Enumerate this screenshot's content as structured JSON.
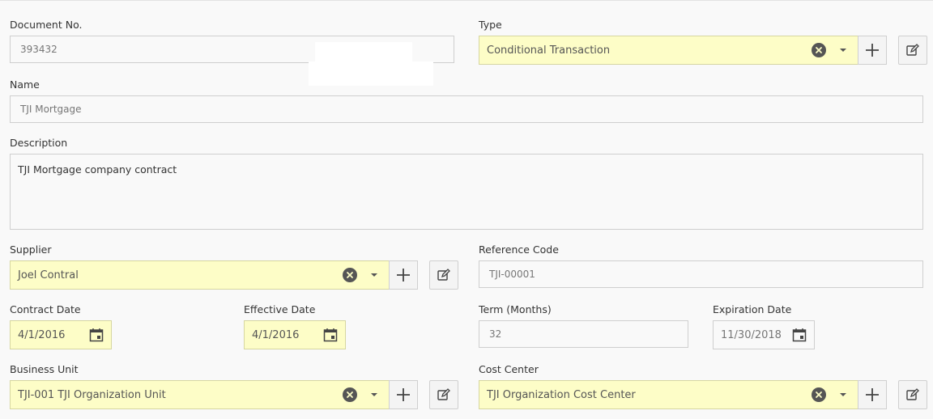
{
  "fields": {
    "document_no": {
      "label": "Document No.",
      "value": "393432"
    },
    "type": {
      "label": "Type",
      "value": "Conditional Transaction"
    },
    "name": {
      "label": "Name",
      "value": "TJI Mortgage"
    },
    "description": {
      "label": "Description",
      "value": "TJI Mortgage company contract"
    },
    "supplier": {
      "label": "Supplier",
      "value": "Joel Contral"
    },
    "reference_code": {
      "label": "Reference Code",
      "value": "TJI-00001"
    },
    "contract_date": {
      "label": "Contract Date",
      "value": "4/1/2016"
    },
    "effective_date": {
      "label": "Effective Date",
      "value": "4/1/2016"
    },
    "term_months": {
      "label": "Term (Months)",
      "value": "32"
    },
    "expiration_date": {
      "label": "Expiration Date",
      "value": "11/30/2018"
    },
    "business_unit": {
      "label": "Business Unit",
      "value": "TJI-001 TJI Organization Unit"
    },
    "cost_center": {
      "label": "Cost Center",
      "value": "TJI Organization Cost Center"
    }
  },
  "colors": {
    "required_fill": "#fdfdc7",
    "border": "#cfcfcf",
    "icon": "#555555"
  },
  "icons": [
    "clear-icon",
    "chevron-down-icon",
    "plus-icon",
    "edit-icon",
    "calendar-icon"
  ]
}
